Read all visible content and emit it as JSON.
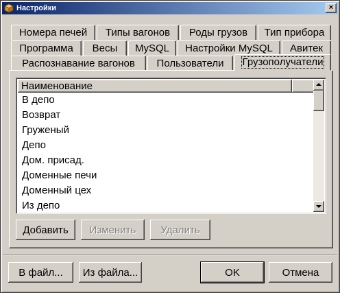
{
  "window": {
    "title": "Настройки",
    "close_glyph": "×"
  },
  "tabs": [
    {
      "label": "Номера печей"
    },
    {
      "label": "Типы вагонов"
    },
    {
      "label": "Роды грузов"
    },
    {
      "label": "Тип прибора"
    },
    {
      "label": "Программа"
    },
    {
      "label": "Весы"
    },
    {
      "label": "MySQL"
    },
    {
      "label": "Настройки MySQL"
    },
    {
      "label": "Авитек"
    },
    {
      "label": "Распознавание вагонов"
    },
    {
      "label": "Пользователи"
    },
    {
      "label": "Грузополучатели"
    }
  ],
  "active_tab": "Грузополучатели",
  "list": {
    "columns": [
      "Наименование",
      ""
    ],
    "rows": [
      "В депо",
      "Возврат",
      "Груженый",
      "Депо",
      "Дом. присад.",
      "Доменные печи",
      "Доменный цех",
      "Из депо"
    ]
  },
  "list_actions": {
    "add": "Добавить",
    "edit": "Изменить",
    "delete": "Удалить"
  },
  "footer": {
    "to_file": "В файл...",
    "from_file": "Из файла...",
    "ok": "OK",
    "cancel": "Отмена"
  },
  "colors": {
    "face": "#d4d0c8",
    "title_start": "#0a246a",
    "title_end": "#a6caf0",
    "disabled_text": "#808080"
  },
  "icons": {
    "app": "package-icon"
  }
}
